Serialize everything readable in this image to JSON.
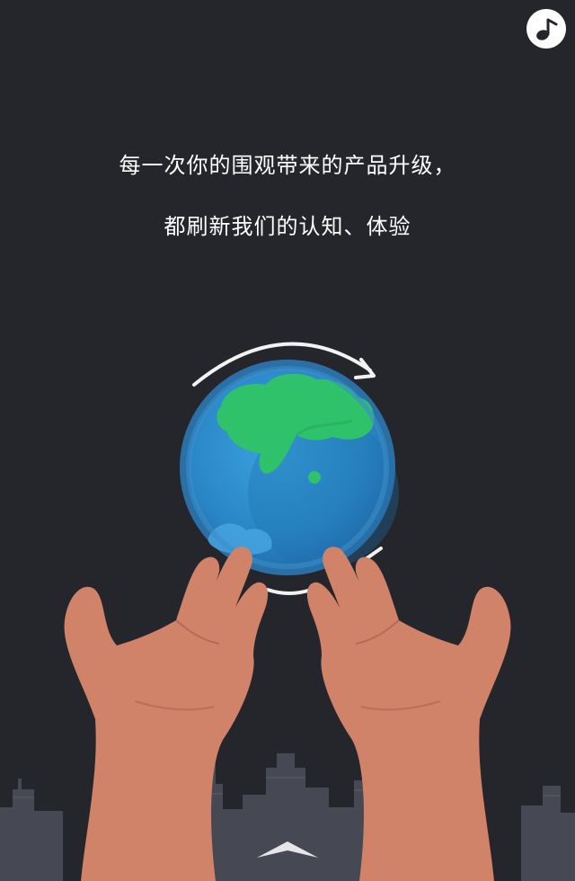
{
  "slogan": {
    "line1": "每一次你的围观带来的产品升级，",
    "line2": "都刷新我们的认知、体验"
  },
  "icons": {
    "music_toggle": "music-note-icon",
    "next_page": "chevron-up-icon",
    "rotate_arrow": "rotate-arrow-icon",
    "globe": "globe-illustration",
    "hands": "hands-illustration",
    "city": "city-skyline-illustration"
  },
  "colors": {
    "background": "#25262b",
    "text": "#ffffff",
    "ocean": "#2f8ed0",
    "land": "#2fc26a",
    "skin": "#d4866c",
    "skyline": "#4a4c58"
  }
}
